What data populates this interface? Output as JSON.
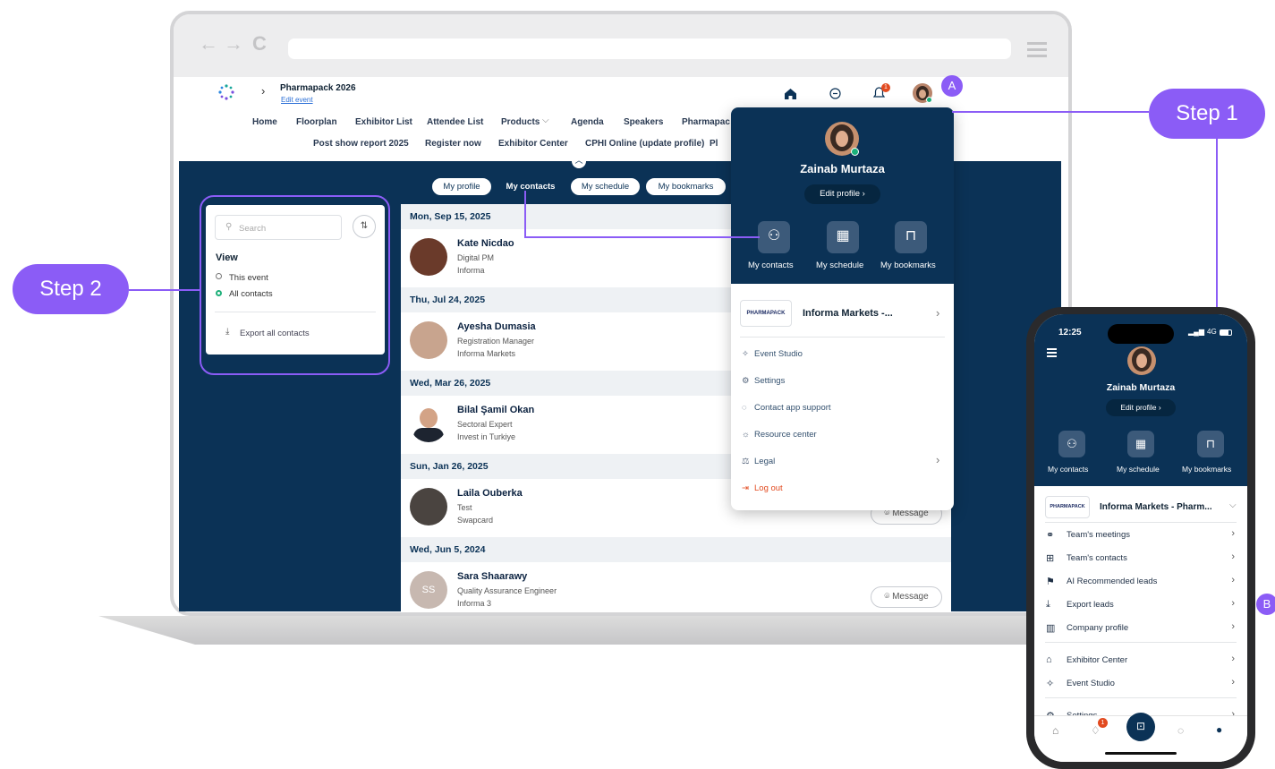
{
  "event": {
    "name": "Pharmapack 2026",
    "edit_link": "Edit event"
  },
  "topnav": {
    "row1": [
      "Home",
      "Floorplan",
      "Exhibitor List",
      "Attendee List",
      "Products",
      "Agenda",
      "Speakers",
      "Pharmapac"
    ],
    "row2": [
      "Post show report 2025",
      "Register now",
      "Exhibitor Center",
      "CPHI Online (update profile)",
      "Pl"
    ]
  },
  "notification_count": "1",
  "subtabs": [
    "My profile",
    "My contacts",
    "My schedule",
    "My bookmarks"
  ],
  "filter": {
    "search_placeholder": "Search",
    "view_label": "View",
    "options": [
      "This event",
      "All contacts"
    ],
    "export_label": "Export all contacts"
  },
  "contacts": [
    {
      "date": "Mon, Sep 15, 2025",
      "name": "Kate Nicdao",
      "title": "Digital PM",
      "company": "Informa"
    },
    {
      "date": "Thu, Jul 24, 2025",
      "name": "Ayesha Dumasia",
      "title": "Registration Manager",
      "company": "Informa Markets"
    },
    {
      "date": "Wed, Mar 26, 2025",
      "name": "Bilal Şamil Okan",
      "title": "Sectoral Expert",
      "company": "Invest in Turkiye"
    },
    {
      "date": "Sun, Jan 26, 2025",
      "name": "Laila Ouberka",
      "title": "Test",
      "company": "Swapcard"
    },
    {
      "date": "Wed, Jun 5, 2024",
      "name": "Sara Shaarawy",
      "title": "Quality Assurance Engineer",
      "company": "Informa 3",
      "initials": "SS"
    }
  ],
  "message_label": "Message",
  "dropdown": {
    "user_name": "Zainab Murtaza",
    "edit_profile": "Edit profile",
    "shortcuts": [
      "My contacts",
      "My schedule",
      "My bookmarks"
    ],
    "org_logo": "PHARMAPACK",
    "org_name": "Informa Markets -...",
    "menu": [
      "Event Studio",
      "Settings",
      "Contact app support",
      "Resource center",
      "Legal"
    ],
    "logout": "Log out"
  },
  "steps": {
    "step1": "Step 1",
    "step2": "Step 2",
    "badge_a": "A",
    "badge_b": "B"
  },
  "phone": {
    "time": "12:25",
    "signal": "4G",
    "user_name": "Zainab Murtaza",
    "edit_profile": "Edit profile",
    "shortcuts": [
      "My contacts",
      "My schedule",
      "My bookmarks"
    ],
    "org_logo": "PHARMAPACK",
    "org_name": "Informa Markets - Pharm...",
    "menu": [
      "Team's meetings",
      "Team's contacts",
      "AI Recommended leads",
      "Export leads",
      "Company profile",
      "Exhibitor Center",
      "Event Studio",
      "Settings"
    ],
    "notification_count": "1"
  },
  "colors": {
    "accent": "#8b5cf6",
    "navy": "#0b3256",
    "alert": "#e24a1f"
  }
}
